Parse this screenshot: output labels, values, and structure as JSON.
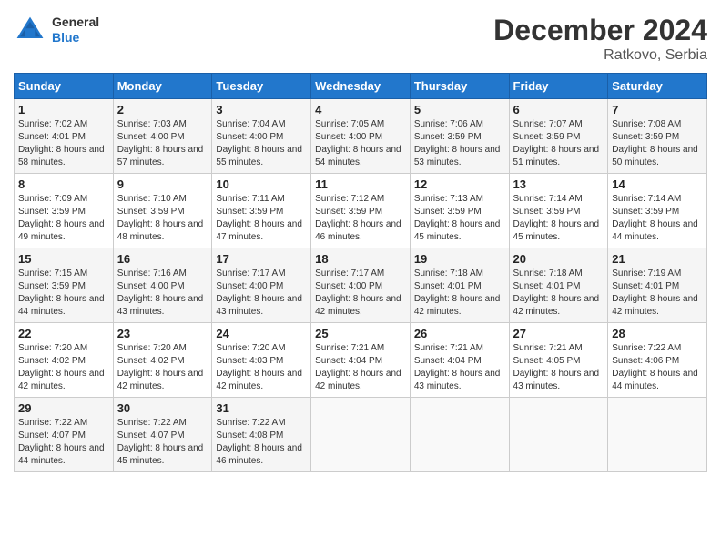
{
  "header": {
    "logo_general": "General",
    "logo_blue": "Blue",
    "title": "December 2024",
    "location": "Ratkovo, Serbia"
  },
  "weekdays": [
    "Sunday",
    "Monday",
    "Tuesday",
    "Wednesday",
    "Thursday",
    "Friday",
    "Saturday"
  ],
  "weeks": [
    [
      {
        "day": "1",
        "sunrise": "7:02 AM",
        "sunset": "4:01 PM",
        "daylight": "8 hours and 58 minutes."
      },
      {
        "day": "2",
        "sunrise": "7:03 AM",
        "sunset": "4:00 PM",
        "daylight": "8 hours and 57 minutes."
      },
      {
        "day": "3",
        "sunrise": "7:04 AM",
        "sunset": "4:00 PM",
        "daylight": "8 hours and 55 minutes."
      },
      {
        "day": "4",
        "sunrise": "7:05 AM",
        "sunset": "4:00 PM",
        "daylight": "8 hours and 54 minutes."
      },
      {
        "day": "5",
        "sunrise": "7:06 AM",
        "sunset": "3:59 PM",
        "daylight": "8 hours and 53 minutes."
      },
      {
        "day": "6",
        "sunrise": "7:07 AM",
        "sunset": "3:59 PM",
        "daylight": "8 hours and 51 minutes."
      },
      {
        "day": "7",
        "sunrise": "7:08 AM",
        "sunset": "3:59 PM",
        "daylight": "8 hours and 50 minutes."
      }
    ],
    [
      {
        "day": "8",
        "sunrise": "7:09 AM",
        "sunset": "3:59 PM",
        "daylight": "8 hours and 49 minutes."
      },
      {
        "day": "9",
        "sunrise": "7:10 AM",
        "sunset": "3:59 PM",
        "daylight": "8 hours and 48 minutes."
      },
      {
        "day": "10",
        "sunrise": "7:11 AM",
        "sunset": "3:59 PM",
        "daylight": "8 hours and 47 minutes."
      },
      {
        "day": "11",
        "sunrise": "7:12 AM",
        "sunset": "3:59 PM",
        "daylight": "8 hours and 46 minutes."
      },
      {
        "day": "12",
        "sunrise": "7:13 AM",
        "sunset": "3:59 PM",
        "daylight": "8 hours and 45 minutes."
      },
      {
        "day": "13",
        "sunrise": "7:14 AM",
        "sunset": "3:59 PM",
        "daylight": "8 hours and 45 minutes."
      },
      {
        "day": "14",
        "sunrise": "7:14 AM",
        "sunset": "3:59 PM",
        "daylight": "8 hours and 44 minutes."
      }
    ],
    [
      {
        "day": "15",
        "sunrise": "7:15 AM",
        "sunset": "3:59 PM",
        "daylight": "8 hours and 44 minutes."
      },
      {
        "day": "16",
        "sunrise": "7:16 AM",
        "sunset": "4:00 PM",
        "daylight": "8 hours and 43 minutes."
      },
      {
        "day": "17",
        "sunrise": "7:17 AM",
        "sunset": "4:00 PM",
        "daylight": "8 hours and 43 minutes."
      },
      {
        "day": "18",
        "sunrise": "7:17 AM",
        "sunset": "4:00 PM",
        "daylight": "8 hours and 42 minutes."
      },
      {
        "day": "19",
        "sunrise": "7:18 AM",
        "sunset": "4:01 PM",
        "daylight": "8 hours and 42 minutes."
      },
      {
        "day": "20",
        "sunrise": "7:18 AM",
        "sunset": "4:01 PM",
        "daylight": "8 hours and 42 minutes."
      },
      {
        "day": "21",
        "sunrise": "7:19 AM",
        "sunset": "4:01 PM",
        "daylight": "8 hours and 42 minutes."
      }
    ],
    [
      {
        "day": "22",
        "sunrise": "7:20 AM",
        "sunset": "4:02 PM",
        "daylight": "8 hours and 42 minutes."
      },
      {
        "day": "23",
        "sunrise": "7:20 AM",
        "sunset": "4:02 PM",
        "daylight": "8 hours and 42 minutes."
      },
      {
        "day": "24",
        "sunrise": "7:20 AM",
        "sunset": "4:03 PM",
        "daylight": "8 hours and 42 minutes."
      },
      {
        "day": "25",
        "sunrise": "7:21 AM",
        "sunset": "4:04 PM",
        "daylight": "8 hours and 42 minutes."
      },
      {
        "day": "26",
        "sunrise": "7:21 AM",
        "sunset": "4:04 PM",
        "daylight": "8 hours and 43 minutes."
      },
      {
        "day": "27",
        "sunrise": "7:21 AM",
        "sunset": "4:05 PM",
        "daylight": "8 hours and 43 minutes."
      },
      {
        "day": "28",
        "sunrise": "7:22 AM",
        "sunset": "4:06 PM",
        "daylight": "8 hours and 44 minutes."
      }
    ],
    [
      {
        "day": "29",
        "sunrise": "7:22 AM",
        "sunset": "4:07 PM",
        "daylight": "8 hours and 44 minutes."
      },
      {
        "day": "30",
        "sunrise": "7:22 AM",
        "sunset": "4:07 PM",
        "daylight": "8 hours and 45 minutes."
      },
      {
        "day": "31",
        "sunrise": "7:22 AM",
        "sunset": "4:08 PM",
        "daylight": "8 hours and 46 minutes."
      },
      null,
      null,
      null,
      null
    ]
  ]
}
